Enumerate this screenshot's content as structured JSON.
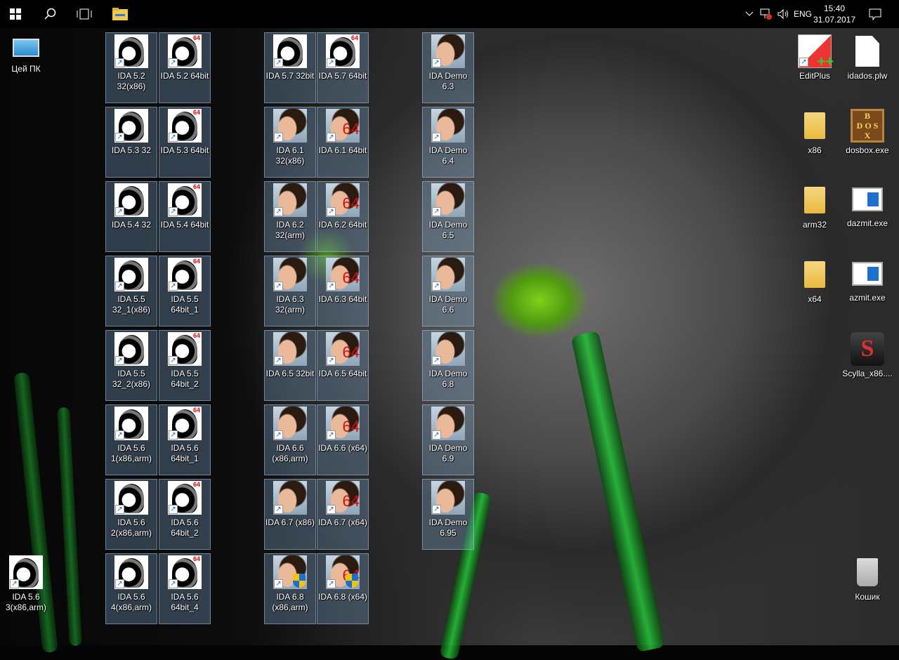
{
  "taskbar": {
    "language": "ENG",
    "time": "15:40",
    "date": "31.07.2017",
    "icons": [
      "windows-start-icon",
      "search-icon",
      "task-view-icon",
      "file-explorer-icon",
      "show-hidden-icons-chevron",
      "network-disconnected-icon",
      "volume-icon",
      "action-center-icon"
    ]
  },
  "desktop": {
    "left": [
      {
        "label": "Цей ПК",
        "icon": "this-pc"
      },
      null,
      null,
      null,
      null,
      null,
      null,
      {
        "label": "IDA 5.6 3(x86,arm)",
        "icon": "ida-old"
      }
    ],
    "col1": [
      {
        "label": "IDA 5.2 32(x86)",
        "icon": "ida-old"
      },
      {
        "label": "IDA 5.3 32",
        "icon": "ida-old"
      },
      {
        "label": "IDA 5.4 32",
        "icon": "ida-old"
      },
      {
        "label": "IDA 5.5 32_1(x86)",
        "icon": "ida-old"
      },
      {
        "label": "IDA 5.5 32_2(x86)",
        "icon": "ida-old"
      },
      {
        "label": "IDA 5.6 1(x86,arm)",
        "icon": "ida-old"
      },
      {
        "label": "IDA 5.6 2(x86,arm)",
        "icon": "ida-old"
      },
      {
        "label": "IDA 5.6 4(x86,arm)",
        "icon": "ida-old"
      }
    ],
    "col2": [
      {
        "label": "IDA 5.2 64bit",
        "icon": "ida-old-64"
      },
      {
        "label": "IDA 5.3 64bit",
        "icon": "ida-old-64"
      },
      {
        "label": "IDA 5.4 64bit",
        "icon": "ida-old-64"
      },
      {
        "label": "IDA 5.5 64bit_1",
        "icon": "ida-old-64"
      },
      {
        "label": "IDA 5.5 64bit_2",
        "icon": "ida-old-64"
      },
      {
        "label": "IDA 5.6 64bit_1",
        "icon": "ida-old-64"
      },
      {
        "label": "IDA 5.6 64bit_2",
        "icon": "ida-old-64"
      },
      {
        "label": "IDA 5.6 64bit_4",
        "icon": "ida-old-64"
      }
    ],
    "col3": [
      {
        "label": "IDA 5.7 32bit",
        "icon": "ida-old"
      },
      {
        "label": "IDA 6.1 32(x86)",
        "icon": "ida-new"
      },
      {
        "label": "IDA 6.2 32(arm)",
        "icon": "ida-new"
      },
      {
        "label": "IDA 6.3 32(arm)",
        "icon": "ida-new"
      },
      {
        "label": "IDA 6.5 32bit",
        "icon": "ida-new"
      },
      {
        "label": "IDA 6.6 (x86,arm)",
        "icon": "ida-new"
      },
      {
        "label": "IDA 6.7 (x86)",
        "icon": "ida-new"
      },
      {
        "label": "IDA 6.8 (x86,arm)",
        "icon": "ida-new-uac"
      }
    ],
    "col4": [
      {
        "label": "IDA 5.7 64bit",
        "icon": "ida-old-64"
      },
      {
        "label": "IDA 6.1 64bit",
        "icon": "ida-new-64"
      },
      {
        "label": "IDA 6.2 64bit",
        "icon": "ida-new-64"
      },
      {
        "label": "IDA 6.3 64bit",
        "icon": "ida-new-64"
      },
      {
        "label": "IDA 6.5 64bit",
        "icon": "ida-new-64"
      },
      {
        "label": "IDA 6.6 (x64)",
        "icon": "ida-new-64"
      },
      {
        "label": "IDA 6.7 (x64)",
        "icon": "ida-new-64"
      },
      {
        "label": "IDA 6.8 (x64)",
        "icon": "ida-new-64-uac"
      }
    ],
    "col5": [
      {
        "label": "IDA Demo 6.3",
        "icon": "ida-new"
      },
      {
        "label": "IDA Demo 6.4",
        "icon": "ida-new"
      },
      {
        "label": "IDA Demo 6.5",
        "icon": "ida-new"
      },
      {
        "label": "IDA Demo 6.6",
        "icon": "ida-new"
      },
      {
        "label": "IDA Demo 6.8",
        "icon": "ida-new"
      },
      {
        "label": "IDA Demo 6.9",
        "icon": "ida-new"
      },
      {
        "label": "IDA Demo 6.95",
        "icon": "ida-new"
      }
    ],
    "right1": [
      {
        "label": "EditPlus",
        "icon": "editplus"
      },
      {
        "label": "x86",
        "icon": "folder"
      },
      {
        "label": "arm32",
        "icon": "folder"
      },
      {
        "label": "x64",
        "icon": "folder"
      }
    ],
    "right2": [
      {
        "label": "idados.plw",
        "icon": "document"
      },
      {
        "label": "dosbox.exe",
        "icon": "dosbox"
      },
      {
        "label": "dazmit.exe",
        "icon": "exe"
      },
      {
        "label": "azmit.exe",
        "icon": "exe"
      },
      {
        "label": "Scylla_x86....",
        "icon": "scylla"
      },
      null,
      null,
      {
        "label": "Кошик",
        "icon": "recycle-bin"
      }
    ],
    "dosbox_text": "DOSBOX"
  }
}
